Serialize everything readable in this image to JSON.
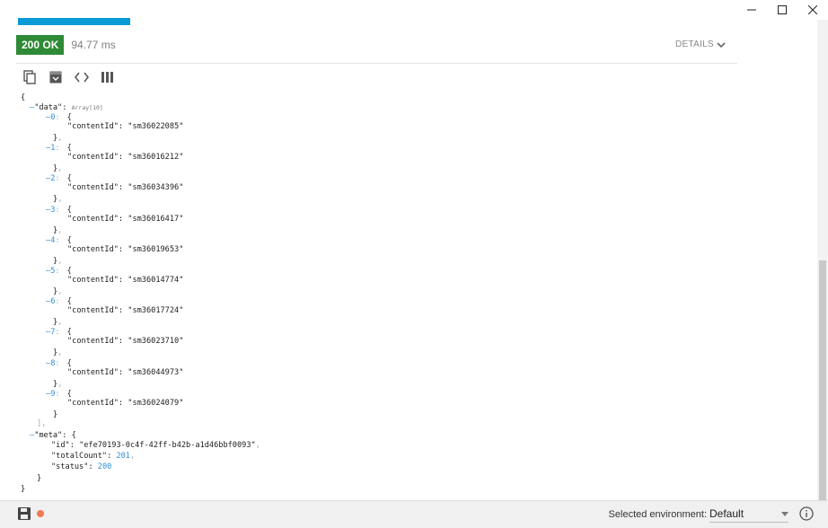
{
  "window": {
    "minimize": "—",
    "maximize": "☐",
    "close": "✕"
  },
  "response": {
    "status": "200 OK",
    "time": "94.77 ms",
    "details_label": "DETAILS"
  },
  "json_view": {
    "lines": [
      {
        "t": "{",
        "x": 0,
        "y": 0
      },
      {
        "t": "data",
        "x": 12,
        "y": 11
      },
      {
        "t": "0",
        "x": 30,
        "y": 22
      },
      {
        "t": "sm36022085"
      },
      {
        "t": "1"
      },
      {
        "t": "sm36016212"
      },
      {
        "t": "2"
      },
      {
        "t": "sm36034396"
      },
      {
        "t": "3"
      },
      {
        "t": "sm36016417"
      },
      {
        "t": "4"
      },
      {
        "t": "sm36019653"
      },
      {
        "t": "5"
      },
      {
        "t": "sm36014774"
      },
      {
        "t": "6"
      },
      {
        "t": "sm36017724"
      },
      {
        "t": "7"
      },
      {
        "t": "sm36023710"
      },
      {
        "t": "8"
      },
      {
        "t": "sm36044973"
      },
      {
        "t": "9"
      },
      {
        "t": "sm36024079"
      }
    ],
    "root_open": "{",
    "root_close": "}",
    "data_key": "\"data\"",
    "array_badge": "Array[10]",
    "item_key": "\"contentId\"",
    "items": [
      {
        "index": "0",
        "contentId": "\"sm36022085\""
      },
      {
        "index": "1",
        "contentId": "\"sm36016212\""
      },
      {
        "index": "2",
        "contentId": "\"sm36034396\""
      },
      {
        "index": "3",
        "contentId": "\"sm36016417\""
      },
      {
        "index": "4",
        "contentId": "\"sm36019653\""
      },
      {
        "index": "5",
        "contentId": "\"sm36014774\""
      },
      {
        "index": "6",
        "contentId": "\"sm36017724\""
      },
      {
        "index": "7",
        "contentId": "\"sm36023710\""
      },
      {
        "index": "8",
        "contentId": "\"sm36044973\""
      },
      {
        "index": "9",
        "contentId": "\"sm36024079\""
      }
    ],
    "meta_key": "\"meta\"",
    "meta": {
      "id_key": "\"id\"",
      "id_value": "\"efe70193-0c4f-42ff-b42b-a1d46bbf0093\"",
      "totalCount_key": "\"totalCount\"",
      "totalCount_value": "201",
      "status_key": "\"status\"",
      "status_value": "200"
    }
  },
  "bottom_bar": {
    "env_label": "Selected environment:",
    "env_value": "Default"
  }
}
